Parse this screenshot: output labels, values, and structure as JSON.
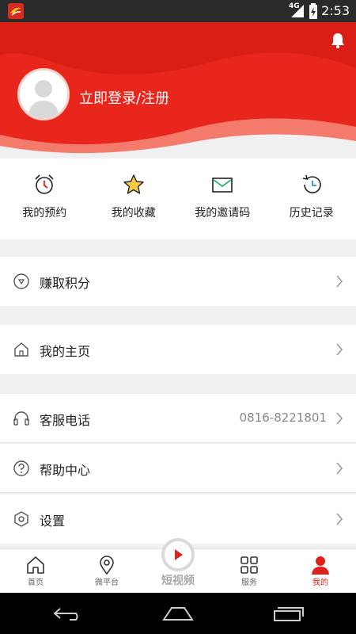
{
  "status_bar": {
    "network": "4G",
    "time": "2:53"
  },
  "colors": {
    "brand": "#e0201b",
    "header_red": "#e8261c",
    "status_bar": "#2a2a2a"
  },
  "header": {
    "login_text": "立即登录/注册",
    "bell_icon": "bell-icon",
    "avatar_icon": "default-avatar-icon"
  },
  "quick_actions": [
    {
      "label": "我的预约",
      "icon": "alarm-clock-icon"
    },
    {
      "label": "我的收藏",
      "icon": "star-icon"
    },
    {
      "label": "我的邀请码",
      "icon": "envelope-icon"
    },
    {
      "label": "历史记录",
      "icon": "history-clock-icon"
    }
  ],
  "menu": [
    {
      "label": "赚取积分",
      "icon": "points-icon"
    },
    {
      "label": "我的主页",
      "icon": "home-icon"
    },
    {
      "label": "客服电话",
      "icon": "headset-icon",
      "value": "0816-8221801"
    },
    {
      "label": "帮助中心",
      "icon": "help-icon"
    },
    {
      "label": "设置",
      "icon": "settings-icon"
    }
  ],
  "tabs": [
    {
      "label": "首页",
      "icon": "home-tab-icon"
    },
    {
      "label": "微平台",
      "icon": "location-pin-icon"
    },
    {
      "label": "短视频",
      "icon": "play-icon"
    },
    {
      "label": "服务",
      "icon": "grid-icon"
    },
    {
      "label": "我的",
      "icon": "person-icon",
      "active": true
    }
  ]
}
